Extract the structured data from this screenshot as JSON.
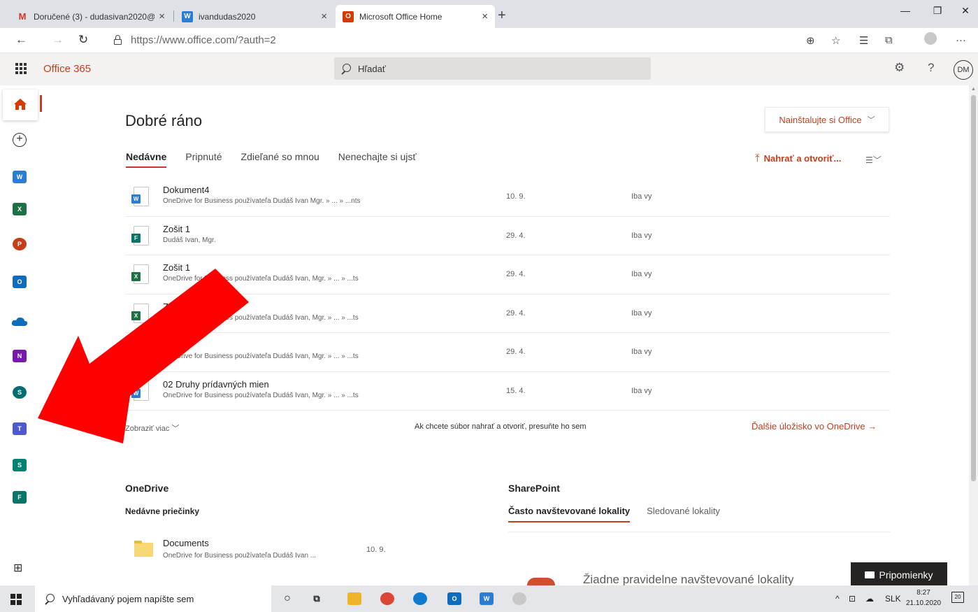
{
  "browser": {
    "tabs": [
      {
        "title": "Doručené (3) - dudasivan2020@",
        "icon": "gmail-icon",
        "active": false
      },
      {
        "title": "ivandudas2020",
        "icon": "word-icon",
        "active": false
      },
      {
        "title": "Microsoft Office Home",
        "icon": "office-icon",
        "active": true
      }
    ],
    "url_host": "https://www.office.com",
    "url_path": "/?auth=2"
  },
  "header": {
    "app_name": "Office 365",
    "search_placeholder": "Hľadať",
    "avatar_initials": "DM"
  },
  "rail": {
    "apps": [
      "home-icon",
      "create-icon",
      "word-icon",
      "excel-icon",
      "powerpoint-icon",
      "outlook-icon",
      "onedrive-icon",
      "onenote-icon",
      "sharepoint-icon",
      "teams-icon",
      "sway-icon",
      "forms-icon",
      "all-apps-icon"
    ]
  },
  "main": {
    "greeting": "Dobré ráno",
    "install_label": "Nainštalujte si Office",
    "tabs": [
      "Nedávne",
      "Pripnuté",
      "Zdieľané so mnou",
      "Nenechajte si ujsť"
    ],
    "upload_label": "Nahrať a otvoriť...",
    "files": [
      {
        "name": "Dokument4",
        "location": "OneDrive for Business používateľa Dudáš Ivan Mgr. » ... » ...nts",
        "date": "10. 9.",
        "shared": "Iba vy",
        "type": "word"
      },
      {
        "name": "Zošit 1",
        "location": "Dudáš Ivan, Mgr.",
        "date": "29. 4.",
        "shared": "Iba vy",
        "type": "forms"
      },
      {
        "name": "Zošit 1",
        "location": "OneDrive for Business používateľa Dudáš Ivan, Mgr. » ... » ...ts",
        "date": "29. 4.",
        "shared": "Iba vy",
        "type": "excel"
      },
      {
        "name": "Zošit 1",
        "location": "OneDrive for Business používateľa Dudáš Ivan, Mgr. » ... » ...ts",
        "date": "29. 4.",
        "shared": "Iba vy",
        "type": "excel"
      },
      {
        "name": "Zošit 1",
        "location": "OneDrive for Business používateľa Dudáš Ivan, Mgr. » ... » ...ts",
        "date": "29. 4.",
        "shared": "Iba vy",
        "type": "excel"
      },
      {
        "name": "02 Druhy prídavných mien",
        "location": "OneDrive for Business používateľa Dudáš Ivan, Mgr. » ... » ...ts",
        "date": "15. 4.",
        "shared": "Iba vy",
        "type": "word"
      }
    ],
    "show_more": "Zobraziť viac",
    "drop_hint": "Ak chcete súbor nahrať a otvoriť, presuňte ho sem",
    "more_onedrive": "Ďalšie úložisko vo OneDrive"
  },
  "onedrive": {
    "title": "OneDrive",
    "subtitle": "Nedávne priečinky",
    "folders": [
      {
        "name": "Documents",
        "location": "OneDrive for Business používateľa Dudáš Ivan ...",
        "date": "10. 9."
      }
    ]
  },
  "sharepoint": {
    "title": "SharePoint",
    "tabs": [
      "Často navštevované lokality",
      "Sledované lokality"
    ],
    "empty_text": "Žiadne pravidelne navštevované lokality"
  },
  "feedback_label": "Pripomienky",
  "taskbar": {
    "search_placeholder": "Vyhľadávaný pojem napíšte sem",
    "language": "SLK",
    "time": "8:27",
    "date": "21.10.2020",
    "notifications": "20"
  },
  "colors": {
    "accent": "#c43e1c",
    "arrow": "#ff0000"
  }
}
